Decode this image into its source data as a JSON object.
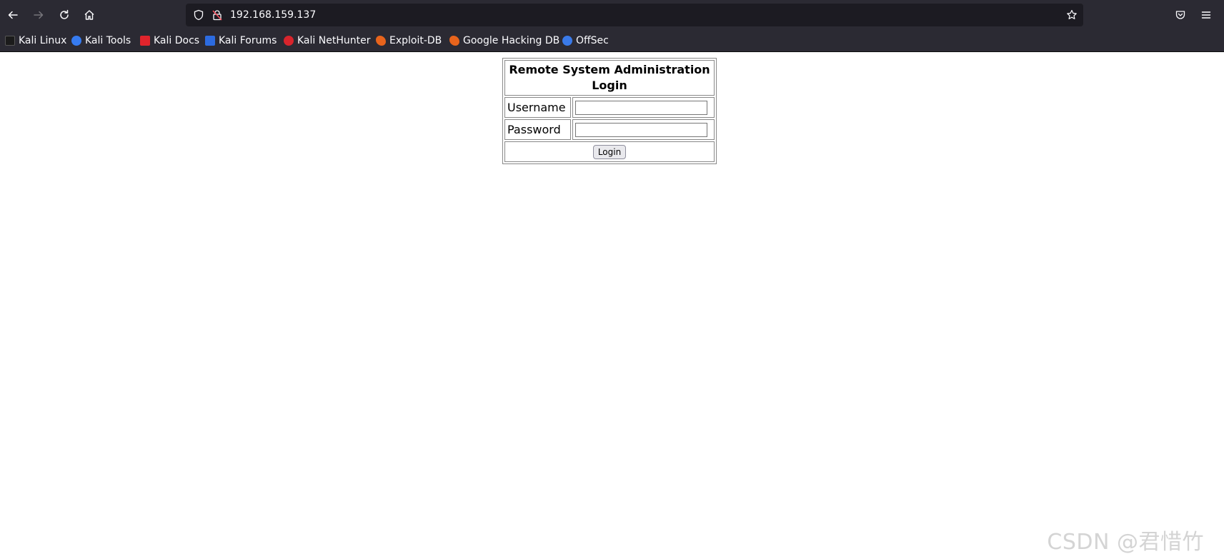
{
  "browser": {
    "url": "192.168.159.137",
    "nav": {
      "back_icon": "arrow-left-icon",
      "forward_icon": "arrow-right-icon",
      "reload_icon": "reload-icon",
      "home_icon": "home-icon"
    }
  },
  "bookmarks": [
    {
      "label": "Kali Linux",
      "icon": "kali-dragon-icon",
      "color": "#1b1b1b"
    },
    {
      "label": "Kali Tools",
      "icon": "kali-tools-icon",
      "color": "#367bf0"
    },
    {
      "label": "Kali Docs",
      "icon": "kali-docs-icon",
      "color": "#e0242c"
    },
    {
      "label": "Kali Forums",
      "icon": "kali-forums-icon",
      "color": "#2c6be0"
    },
    {
      "label": "Kali NetHunter",
      "icon": "nethunter-icon",
      "color": "#d8242c"
    },
    {
      "label": "Exploit-DB",
      "icon": "exploit-db-icon",
      "color": "#e8641c"
    },
    {
      "label": "Google Hacking DB",
      "icon": "ghdb-icon",
      "color": "#e8641c"
    },
    {
      "label": "OffSec",
      "icon": "offsec-icon",
      "color": "#3a7ae8"
    }
  ],
  "login_form": {
    "title": "Remote System Administration Login",
    "username_label": "Username",
    "password_label": "Password",
    "username_value": "",
    "password_value": "",
    "submit_label": "Login"
  },
  "watermark": "CSDN @君惜竹"
}
